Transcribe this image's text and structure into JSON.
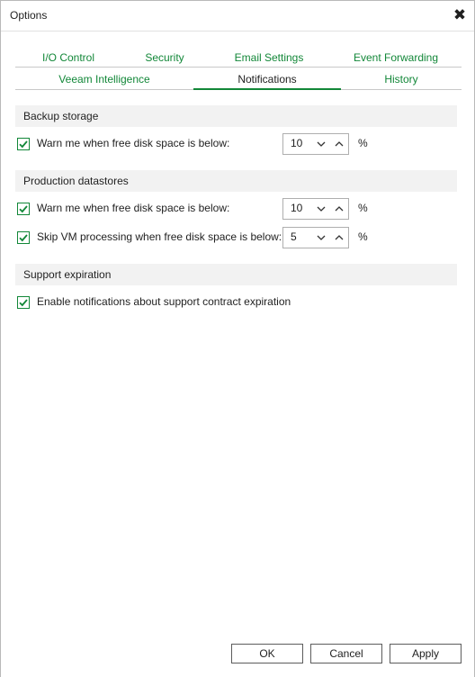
{
  "window": {
    "title": "Options",
    "close_glyph": "✖"
  },
  "tabs": {
    "row1": [
      {
        "label": "I/O Control"
      },
      {
        "label": "Security"
      },
      {
        "label": "Email Settings"
      },
      {
        "label": "Event Forwarding"
      }
    ],
    "row2": [
      {
        "label": "Veeam Intelligence"
      },
      {
        "label": "Notifications",
        "active": true
      },
      {
        "label": "History"
      }
    ]
  },
  "sections": {
    "backup_storage": {
      "title": "Backup storage",
      "warn": {
        "label": "Warn me when free disk space is below:",
        "checked": true,
        "value": "10",
        "unit": "%"
      }
    },
    "production_datastores": {
      "title": "Production datastores",
      "warn": {
        "label": "Warn me when free disk space is below:",
        "checked": true,
        "value": "10",
        "unit": "%"
      },
      "skip": {
        "label": "Skip VM processing when free disk space is below:",
        "checked": true,
        "value": "5",
        "unit": "%"
      }
    },
    "support_expiration": {
      "title": "Support expiration",
      "enable": {
        "label": "Enable notifications about support contract expiration",
        "checked": true
      }
    }
  },
  "buttons": {
    "ok": "OK",
    "cancel": "Cancel",
    "apply": "Apply"
  },
  "colors": {
    "accent": "#128738",
    "header_bg": "#f2f2f2",
    "border": "#aeaeae"
  }
}
